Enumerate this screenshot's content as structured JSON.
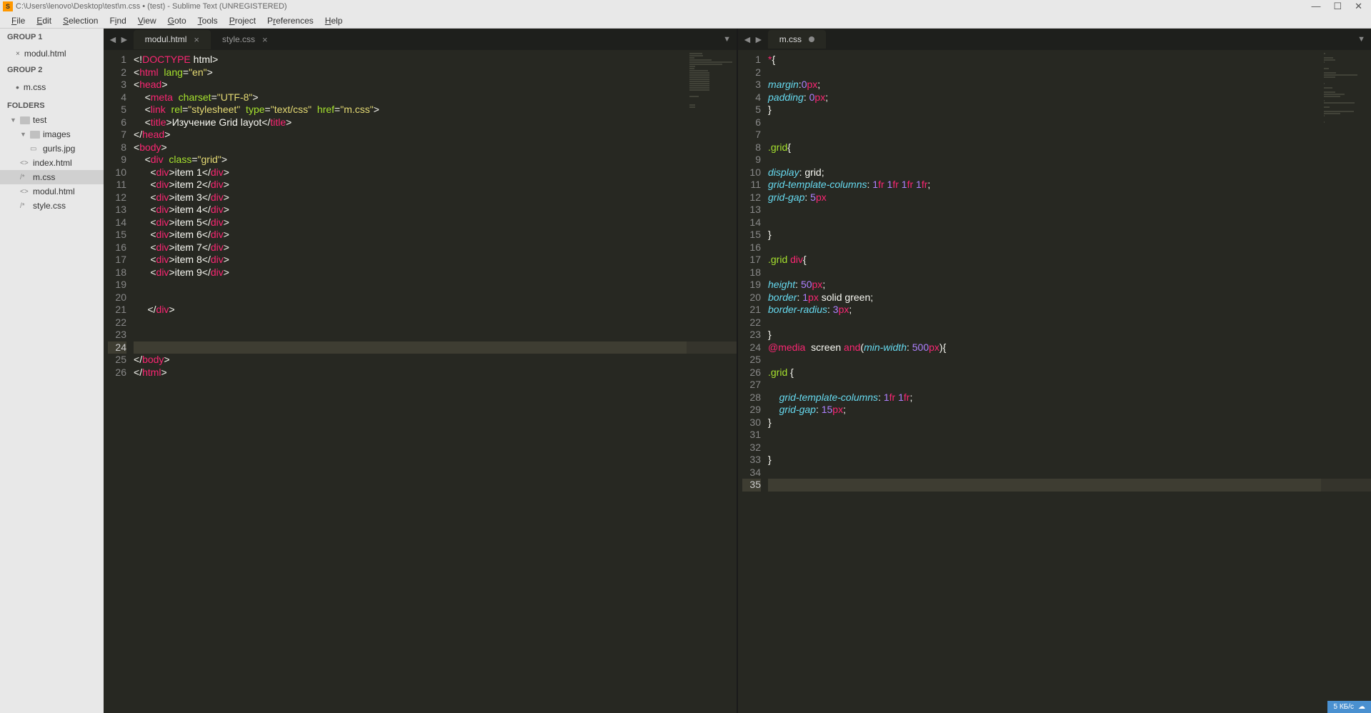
{
  "titlebar": {
    "path": "C:\\Users\\lenovo\\Desktop\\test\\m.css • (test) - Sublime Text (UNREGISTERED)"
  },
  "menu": {
    "file": "File",
    "edit": "Edit",
    "selection": "Selection",
    "find": "Find",
    "view": "View",
    "goto": "Goto",
    "tools": "Tools",
    "project": "Project",
    "preferences": "Preferences",
    "help": "Help"
  },
  "sidebar": {
    "group1": "GROUP 1",
    "group2": "GROUP 2",
    "folders": "FOLDERS",
    "open_files": {
      "g1": [
        {
          "name": "modul.html",
          "dirty": false
        }
      ],
      "g2": [
        {
          "name": "m.css",
          "dirty": true
        }
      ]
    },
    "tree": {
      "root": "test",
      "images": "images",
      "gurls": "gurls.jpg",
      "index": "index.html",
      "mcss": "m.css",
      "modul": "modul.html",
      "style": "style.css"
    }
  },
  "tabs": {
    "left": [
      {
        "name": "modul.html",
        "active": true,
        "dirty": false
      },
      {
        "name": "style.css",
        "active": false,
        "dirty": false
      }
    ],
    "right": [
      {
        "name": "m.css",
        "active": true,
        "dirty": true
      }
    ]
  },
  "code_left": {
    "raw": "<!DOCTYPE html>\n<html lang=\"en\">\n<head>\n    <meta charset=\"UTF-8\">\n    <link rel=\"stylesheet\" type=\"text/css\" href=\"m.css\">\n    <title>Изучение Grid layot</title>\n</head>\n<body>\n    <div class=\"grid\">\n      <div>item 1</div>\n      <div>item 2</div>\n      <div>item 3</div>\n      <div>item 4</div>\n      <div>item 5</div>\n      <div>item 6</div>\n      <div>item 7</div>\n      <div>item 8</div>\n      <div>item 9</div>\n\n\n     </div>\n\n\n\n</body>\n</html>",
    "active_line": 24,
    "line_count": 26
  },
  "code_right": {
    "raw": "*{\n\nmargin:0px;\npadding: 0px;\n}\n\n\n.grid{\n\ndisplay: grid;\ngrid-template-columns: 1fr 1fr 1fr 1fr;\ngrid-gap: 5px\n\n\n}\n\n.grid div{\n\nheight: 50px;\nborder: 1px solid green;\nborder-radius: 3px;\n\n}\n@media screen and(min-width: 500px){\n\n.grid {\n\n    grid-template-columns: 1fr 1fr;\n    grid-gap: 15px;\n}\n\n\n}\n\n",
    "active_line": 35,
    "line_count": 35
  },
  "status": {
    "text": "5 КБ/с"
  }
}
